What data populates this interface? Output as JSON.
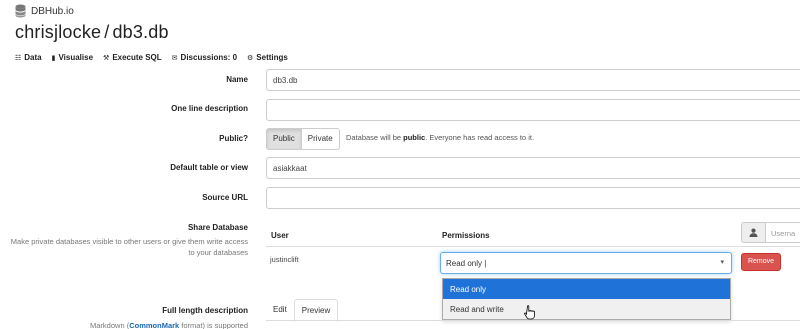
{
  "brand": {
    "name": "DBHub.io",
    "icon": "database-icon"
  },
  "title": {
    "owner": "chrisjlocke",
    "separator": "/",
    "db": "db3.db"
  },
  "tabs": [
    {
      "label": "Data",
      "icon": "database-icon"
    },
    {
      "label": "Visualise",
      "icon": "bar-chart-icon"
    },
    {
      "label": "Execute SQL",
      "icon": "wrench-icon"
    },
    {
      "label": "Discussions: 0",
      "icon": "comment-icon"
    },
    {
      "label": "Settings",
      "icon": "gear-icon"
    }
  ],
  "form": {
    "name": {
      "label": "Name",
      "value": "db3.db"
    },
    "description": {
      "label": "One line description",
      "value": ""
    },
    "public": {
      "label": "Public?",
      "options": [
        "Public",
        "Private"
      ],
      "selected": "Public",
      "note_prefix": "Database will be",
      "note_bold": "public",
      "note_suffix": ". Everyone has read access to it."
    },
    "default_table": {
      "label": "Default table or view",
      "value": "asiakkaat"
    },
    "source_url": {
      "label": "Source URL",
      "value": ""
    }
  },
  "share": {
    "label": "Share Database",
    "hint": "Make private databases visible to other users or give them write access to your databases",
    "col_user": "User",
    "col_permissions": "Permissions",
    "username_placeholder": "Userna",
    "row": {
      "user": "justinclift",
      "permission": "Read only |",
      "remove_label": "Remove"
    },
    "options": [
      "Read only",
      "Read and write"
    ],
    "selected_option": "Read only"
  },
  "full_length": {
    "label": "Full length description",
    "hint_prefix": "Markdown (",
    "hint_link": "CommonMark",
    "hint_suffix": " format) is supported",
    "tabs": [
      "Edit",
      "Preview"
    ],
    "active_tab": "Preview"
  },
  "colors": {
    "accent": "#1e72d8",
    "danger": "#d9534f",
    "focus": "#66afe9"
  }
}
